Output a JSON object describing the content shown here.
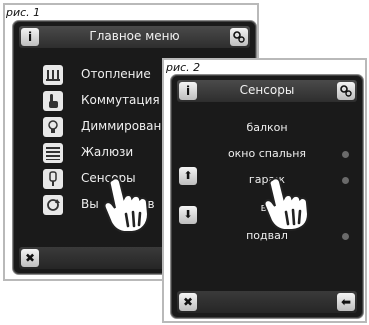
{
  "captions": [
    "рис. 1",
    "рис. 2"
  ],
  "screen1": {
    "title": "Главное меню",
    "items": [
      {
        "label": "Отопление",
        "icon": "heating-icon"
      },
      {
        "label": "Коммутация",
        "icon": "hand-switch-icon"
      },
      {
        "label": "Диммирован",
        "icon": "bulb-icon"
      },
      {
        "label": "Жалюзи",
        "icon": "blinds-icon"
      },
      {
        "label": "Сенсоры",
        "icon": "sensor-icon"
      },
      {
        "label": "Вы",
        "icon": "refresh-icon"
      }
    ],
    "item_partial_suffix": "прав"
  },
  "screen2": {
    "title": "Сенсоры",
    "items": [
      {
        "label": "балкон",
        "dot": false
      },
      {
        "label": "окно спальня",
        "dot": true
      },
      {
        "label": "гараж",
        "dot": true
      },
      {
        "label": "вх",
        "dot": false
      },
      {
        "label": "подвал",
        "dot": true
      }
    ]
  },
  "buttons": {
    "info": "i",
    "close": "✖",
    "back": "⬅",
    "up": "⬆",
    "down": "⬇"
  },
  "colors": {
    "screen_bg": "#1a1a1a",
    "bar": "#3a3a3a",
    "text": "#f0f0f0",
    "button": "#dcdcdc"
  }
}
